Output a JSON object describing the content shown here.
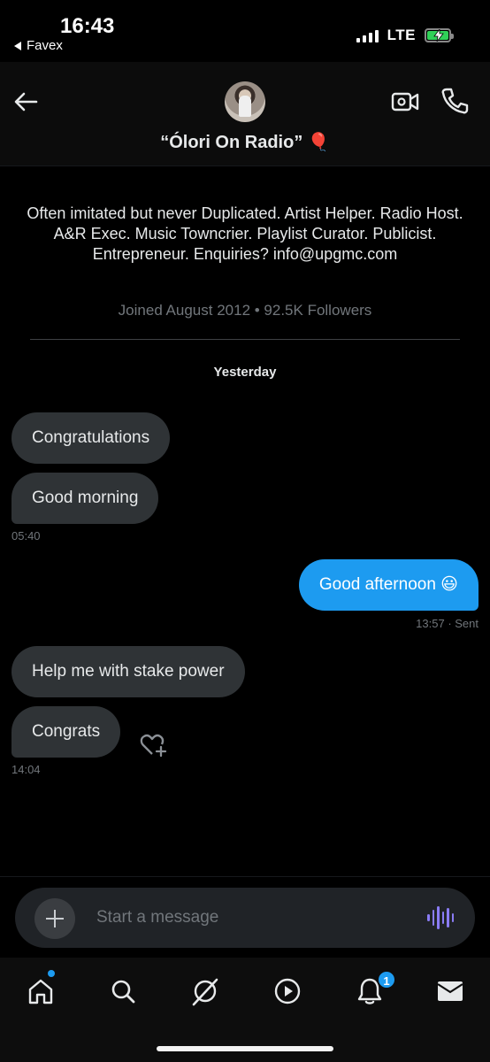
{
  "status_bar": {
    "time": "16:43",
    "back_app": "Favex",
    "network": "LTE",
    "battery_state": "charging"
  },
  "header": {
    "title": "“Ólori On Radio” 🎈",
    "avatar_alt": "profile photo",
    "icons": [
      "back-arrow-icon",
      "video-call-icon",
      "phone-call-icon"
    ]
  },
  "profile": {
    "bio": "Often imitated but never Duplicated. Artist Helper. Radio Host. A&R Exec. Music Towncrier. Playlist Curator. Publicist. Entrepreneur. Enquiries? info@upgmc.com",
    "joined": "Joined August 2012 • 92.5K Followers"
  },
  "conversation": {
    "day_label": "Yesterday",
    "messages": [
      {
        "direction": "received",
        "text": "Congratulations"
      },
      {
        "direction": "received",
        "text": "Good morning",
        "time": "05:40"
      },
      {
        "direction": "sent",
        "text": "Good afternoon 😃",
        "time": "13:57 · Sent"
      },
      {
        "direction": "received",
        "text": "Help me with stake power"
      },
      {
        "direction": "received",
        "text": "Congrats",
        "time": "14:04"
      }
    ]
  },
  "composer": {
    "placeholder": "Start a message"
  },
  "bottom_nav": {
    "items": [
      "home-icon",
      "search-icon",
      "grok-icon",
      "video-icon",
      "notifications-icon",
      "messages-icon"
    ],
    "notifications_badge": "1",
    "accent_color": "#1d9bf0"
  }
}
